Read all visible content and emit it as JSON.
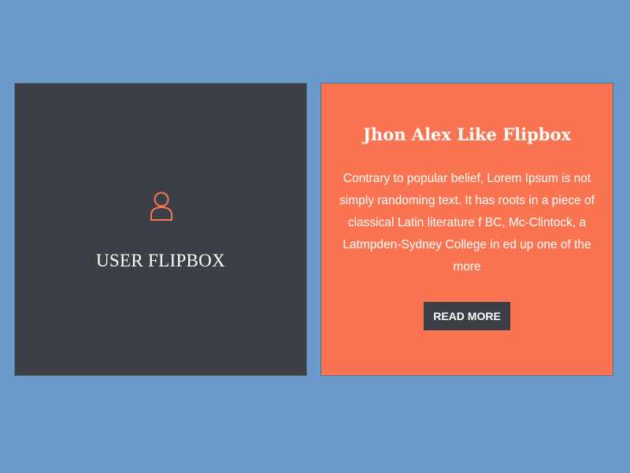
{
  "colors": {
    "background": "#6a9bcb",
    "front_card": "#3c3f45",
    "back_card": "#fb7452",
    "accent": "#fb7452",
    "button": "#3c3f45"
  },
  "front": {
    "icon": "user-icon",
    "title": "USER FLIPBOX"
  },
  "back": {
    "title": "Jhon Alex Like Flipbox",
    "text": "Contrary to popular belief, Lorem Ipsum is not simply randoming text. It has roots in a piece of classical Latin literature f BC, Mc-Clintock, a Latmpden-Sydney College in ed up one of the more",
    "button_label": "READ MORE"
  }
}
